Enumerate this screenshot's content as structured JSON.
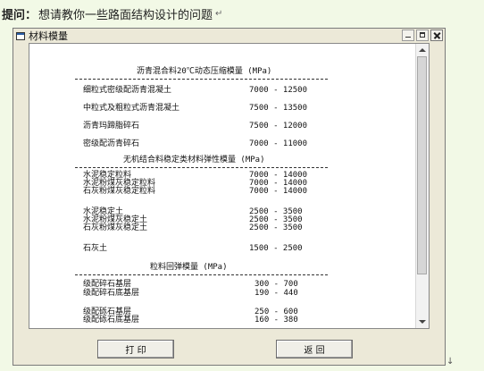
{
  "question": {
    "prefix": "提问：",
    "text": "想请教你一些路面结构设计的问题",
    "return_mark": "↵"
  },
  "window": {
    "title": "材料模量",
    "icon": "window-app-icon",
    "controls": [
      "minimize-icon",
      "maximize-icon",
      "close-icon"
    ]
  },
  "sheet": {
    "section1": {
      "title": "沥青混合料20℃动态压缩模量 (MPa)",
      "rows": [
        {
          "name": "细粒式密级配沥青混凝土",
          "range": "7000 - 12500"
        },
        {
          "name": "中粒式及粗粒式沥青混凝土",
          "range": "7500 - 13500"
        },
        {
          "name": "沥青玛蹄脂碎石",
          "range": "7500 - 12000"
        },
        {
          "name": "密级配沥青碎石",
          "range": "7000 - 11000"
        }
      ]
    },
    "section2": {
      "title": "无机结合料稳定类材料弹性模量 (MPa)",
      "rows": [
        {
          "name": "水泥稳定粒料",
          "range": "7000 - 14000"
        },
        {
          "name": "水泥粉煤灰稳定粒料",
          "range": "7000 - 14000"
        },
        {
          "name": "石灰粉煤灰稳定粒料",
          "range": "7000 - 14000"
        },
        {
          "name": "水泥稳定土",
          "range": "2500 - 3500"
        },
        {
          "name": "水泥粉煤灰稳定土",
          "range": "2500 - 3500"
        },
        {
          "name": "石灰粉煤灰稳定土",
          "range": "2500 - 3500"
        },
        {
          "name": "石灰土",
          "range": "1500 - 2500"
        }
      ]
    },
    "section3": {
      "title": "粒料回弹模量 (MPa)",
      "rows": [
        {
          "name": "级配碎石基层",
          "range": "300 - 700"
        },
        {
          "name": "级配碎石底基层",
          "range": "190 - 440"
        },
        {
          "name": "级配砾石基层",
          "range": "250 - 600"
        },
        {
          "name": "级配砾石底基层",
          "range": "160 - 380"
        }
      ]
    }
  },
  "buttons": {
    "print": "打  印",
    "back": "返  回"
  },
  "scrollbar": {
    "up_icon": "scroll-up-arrow-icon",
    "down_icon": "scroll-down-arrow-icon"
  },
  "colors": {
    "page_bg": "#f2f9e6",
    "window_bg": "#ece9d8",
    "content_bg": "#ffffff"
  }
}
